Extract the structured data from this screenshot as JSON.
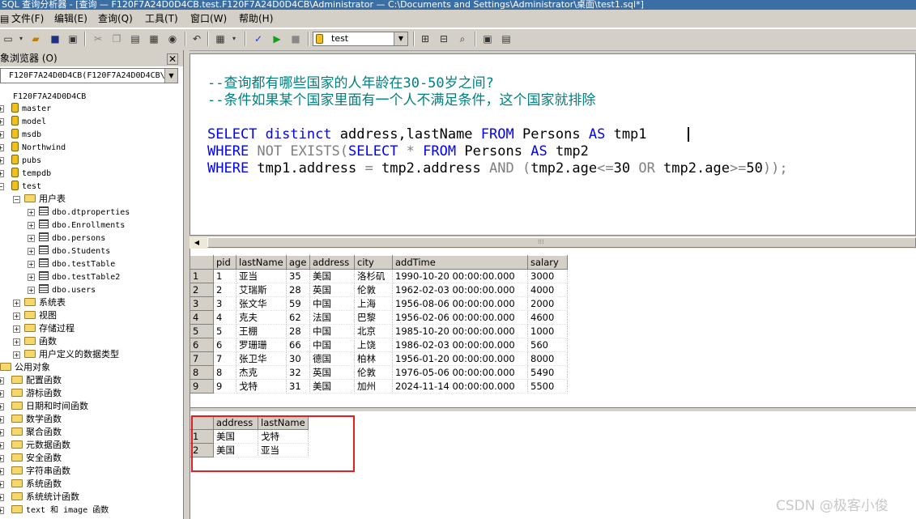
{
  "window": {
    "title": "SQL 查询分析器 - [查询 — F120F7A24D0D4CB.test.F120F7A24D0D4CB\\Administrator — C:\\Documents and Settings\\Administrator\\桌面\\test1.sql*]"
  },
  "menu": {
    "items": [
      "文件(F)",
      "编辑(E)",
      "查询(Q)",
      "工具(T)",
      "窗口(W)",
      "帮助(H)"
    ]
  },
  "toolbar": {
    "database_selector": "test"
  },
  "object_browser": {
    "title": "象浏览器 (O)",
    "close_label": "✕",
    "server_combo": "F120F7A24D0D4CB(F120F7A24D0D4CB\\",
    "server": "F120F7A24D0D4CB",
    "databases": [
      "master",
      "model",
      "msdb",
      "Northwind",
      "pubs",
      "tempdb",
      "test"
    ],
    "test_folders": {
      "user_tables": "用户表",
      "system_tables": "系统表",
      "views": "视图",
      "stored_procedures": "存储过程",
      "functions": "函数",
      "user_types": "用户定义的数据类型"
    },
    "user_tables": [
      "dbo.dtproperties",
      "dbo.Enrollments",
      "dbo.persons",
      "dbo.Students",
      "dbo.testTable",
      "dbo.testTable2",
      "dbo.users"
    ],
    "common_objects": "公用对象",
    "common_items": [
      "配置函数",
      "游标函数",
      "日期和时间函数",
      "数学函数",
      "聚合函数",
      "元数据函数",
      "安全函数",
      "字符串函数",
      "系统函数",
      "系统统计函数",
      "text 和 image 函数"
    ]
  },
  "editor": {
    "comment1": "--查询都有哪些国家的人年龄在30-50岁之间?",
    "comment2": "--条件如果某个国家里面有一个人不满足条件，这个国家就排除",
    "l1": {
      "a": "SELECT",
      "b": " distinct",
      "c": " address,lastName",
      "d": " FROM",
      "e": " Persons",
      "f": " AS",
      "g": " tmp1"
    },
    "l2": {
      "a": "WHERE",
      "b": " NOT EXISTS(",
      "c": "SELECT",
      "d": " *",
      "e": " FROM",
      "f": " Persons",
      "g": " AS",
      "h": " tmp2"
    },
    "l3": {
      "a": "WHERE",
      "b": " tmp1.address",
      "c": " =",
      "d": " tmp2.address",
      "e": " AND",
      "f": " (",
      "g": "tmp2.age",
      "h": "<=",
      "i": "30",
      "j": " OR",
      "k": " tmp2.age",
      "l": ">=",
      "m": "50",
      "n": "));"
    }
  },
  "result1": {
    "columns": [
      "pid",
      "lastName",
      "age",
      "address",
      "city",
      "addTime",
      "salary"
    ],
    "rows": [
      [
        "1",
        "1",
        "亚当",
        "35",
        "美国",
        "洛杉矶",
        "1990-10-20 00:00:00.000",
        "3000"
      ],
      [
        "2",
        "2",
        "艾瑞斯",
        "28",
        "英国",
        "伦敦",
        "1962-02-03 00:00:00.000",
        "4000"
      ],
      [
        "3",
        "3",
        "张文华",
        "59",
        "中国",
        "上海",
        "1956-08-06 00:00:00.000",
        "2000"
      ],
      [
        "4",
        "4",
        "克夫",
        "62",
        "法国",
        "巴黎",
        "1956-02-06 00:00:00.000",
        "4600"
      ],
      [
        "5",
        "5",
        "王棚",
        "28",
        "中国",
        "北京",
        "1985-10-20 00:00:00.000",
        "1000"
      ],
      [
        "6",
        "6",
        "罗珊珊",
        "66",
        "中国",
        "上饶",
        "1986-02-03 00:00:00.000",
        "560"
      ],
      [
        "7",
        "7",
        "张卫华",
        "30",
        "德国",
        "柏林",
        "1956-01-20 00:00:00.000",
        "8000"
      ],
      [
        "8",
        "8",
        "杰克",
        "32",
        "英国",
        "伦敦",
        "1976-05-06 00:00:00.000",
        "5490"
      ],
      [
        "9",
        "9",
        "戈特",
        "31",
        "美国",
        "加州",
        "2024-11-14 00:00:00.000",
        "5500"
      ]
    ]
  },
  "result2": {
    "columns": [
      "address",
      "lastName"
    ],
    "rows": [
      [
        "1",
        "美国",
        "戈特"
      ],
      [
        "2",
        "美国",
        "亚当"
      ]
    ]
  },
  "watermark": "CSDN @极客小俊",
  "colors": {
    "comment": "#008080",
    "keyword": "#0000ff",
    "operator": "#808080",
    "highlight": "#e02020"
  }
}
